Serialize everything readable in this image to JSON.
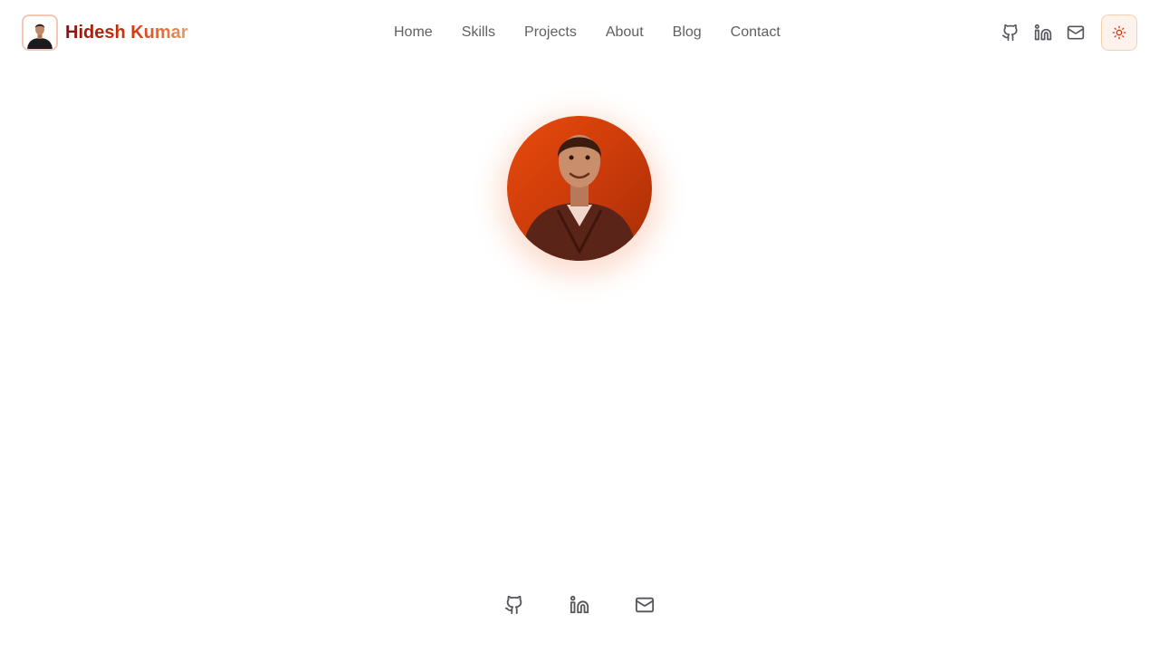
{
  "header": {
    "brand_name": "Hidesh Kumar",
    "nav": [
      {
        "label": "Home"
      },
      {
        "label": "Skills"
      },
      {
        "label": "Projects"
      },
      {
        "label": "About"
      },
      {
        "label": "Blog"
      },
      {
        "label": "Contact"
      }
    ],
    "icons": [
      "github-icon",
      "linkedin-icon",
      "mail-icon",
      "sun-icon"
    ]
  },
  "footer": {
    "icons": [
      "github-icon",
      "linkedin-icon",
      "mail-icon"
    ]
  },
  "colors": {
    "accent": "#d4380d",
    "accent_dark": "#8a0f0f",
    "accent_light": "#e8a06a",
    "nav_text": "#5f5f66",
    "toggle_bg": "#fdf3ec",
    "toggle_border": "#f6cfae",
    "avatar_orange": "#e84b0c"
  }
}
